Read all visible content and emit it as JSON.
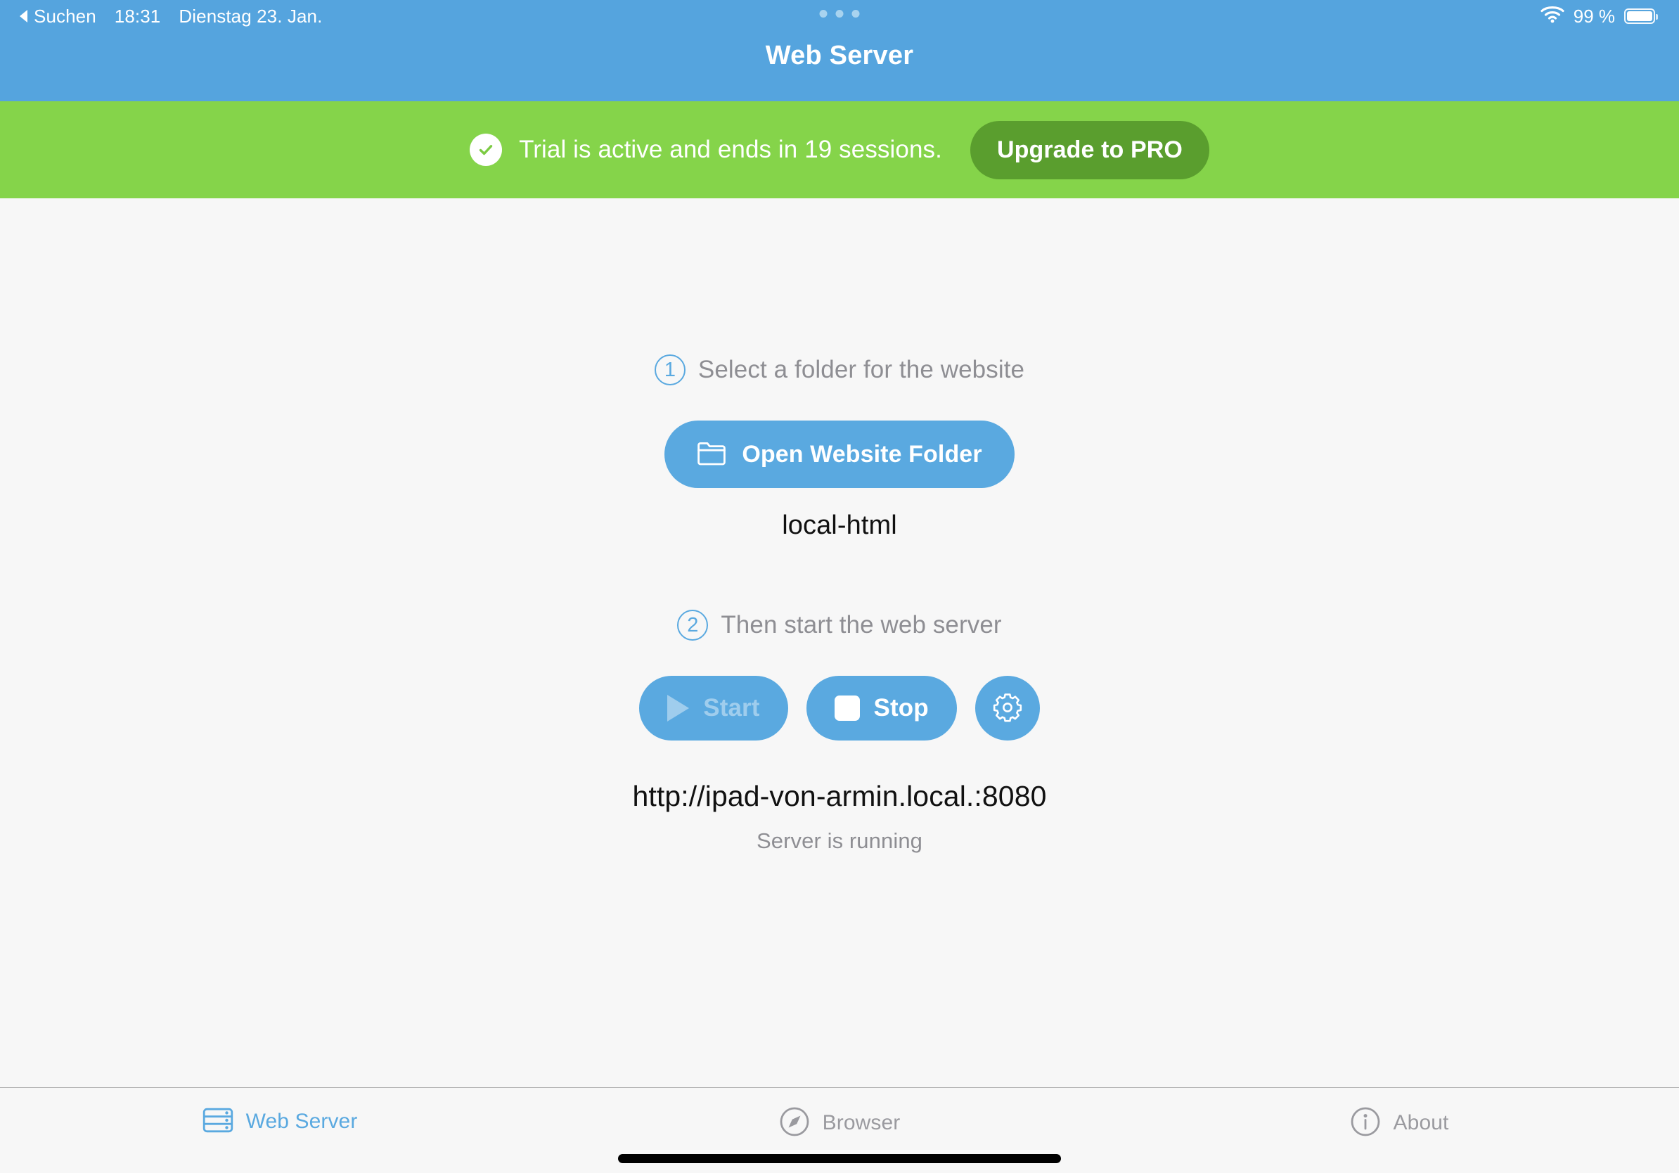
{
  "status_bar": {
    "back_label": "Suchen",
    "time": "18:31",
    "date": "Dienstag 23. Jan.",
    "battery_percent": "99 %",
    "wifi_icon": "wifi-icon",
    "battery_icon": "battery-full-icon",
    "back_icon": "back-triangle-icon"
  },
  "header": {
    "title": "Web Server",
    "background_color": "#55a4de",
    "multitask_handle_icon": "multitask-dots-icon"
  },
  "trial_banner": {
    "message": "Trial is active and ends in 19 sessions.",
    "upgrade_label": "Upgrade to PRO",
    "check_icon": "check-circle-icon",
    "background_color": "#85d44a",
    "button_color": "#5a9e2e"
  },
  "main": {
    "step1": {
      "number": "1",
      "label": "Select a folder for the website",
      "folder_button_label": "Open Website Folder",
      "folder_button_icon": "folder-icon",
      "selected_folder": "local-html"
    },
    "step2": {
      "number": "2",
      "label": "Then start the web server",
      "start_label": "Start",
      "start_icon": "play-icon",
      "stop_label": "Stop",
      "stop_icon": "stop-icon",
      "settings_icon": "gear-icon",
      "server_url": "http://ipad-von-armin.local.:8080",
      "server_status": "Server is running"
    },
    "accent_color": "#5aa9e0"
  },
  "tab_bar": {
    "items": [
      {
        "label": "Web Server",
        "icon": "server-rack-icon",
        "active": true
      },
      {
        "label": "Browser",
        "icon": "compass-icon",
        "active": false
      },
      {
        "label": "About",
        "icon": "info-circle-icon",
        "active": false
      }
    ]
  }
}
